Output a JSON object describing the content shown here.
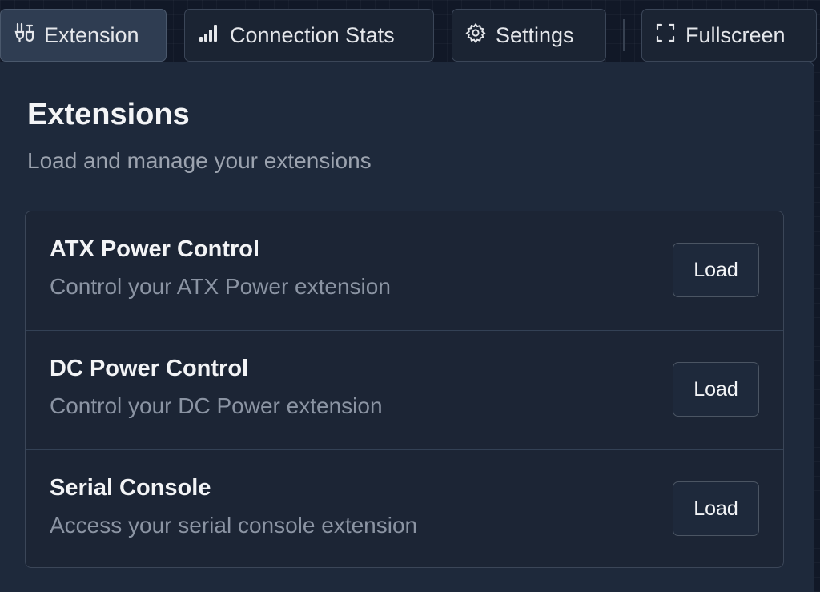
{
  "toolbar": {
    "extension_label": "Extension",
    "connection_stats_label": "Connection Stats",
    "settings_label": "Settings",
    "fullscreen_label": "Fullscreen"
  },
  "icons": {
    "extension": "plug-icon",
    "connection_stats": "signal-bars-icon",
    "settings": "gear-icon",
    "fullscreen": "fullscreen-icon"
  },
  "panel": {
    "title": "Extensions",
    "subtitle": "Load and manage your extensions",
    "extensions": [
      {
        "name": "ATX Power Control",
        "description": "Control your ATX Power extension",
        "button_label": "Load"
      },
      {
        "name": "DC Power Control",
        "description": "Control your DC Power extension",
        "button_label": "Load"
      },
      {
        "name": "Serial Console",
        "description": "Access your serial console extension",
        "button_label": "Load"
      }
    ]
  },
  "colors": {
    "background": "#111827",
    "panel": "#1e293b",
    "text_primary": "#f3f4f6",
    "text_secondary": "#9ca3af",
    "border": "#3b4658"
  }
}
